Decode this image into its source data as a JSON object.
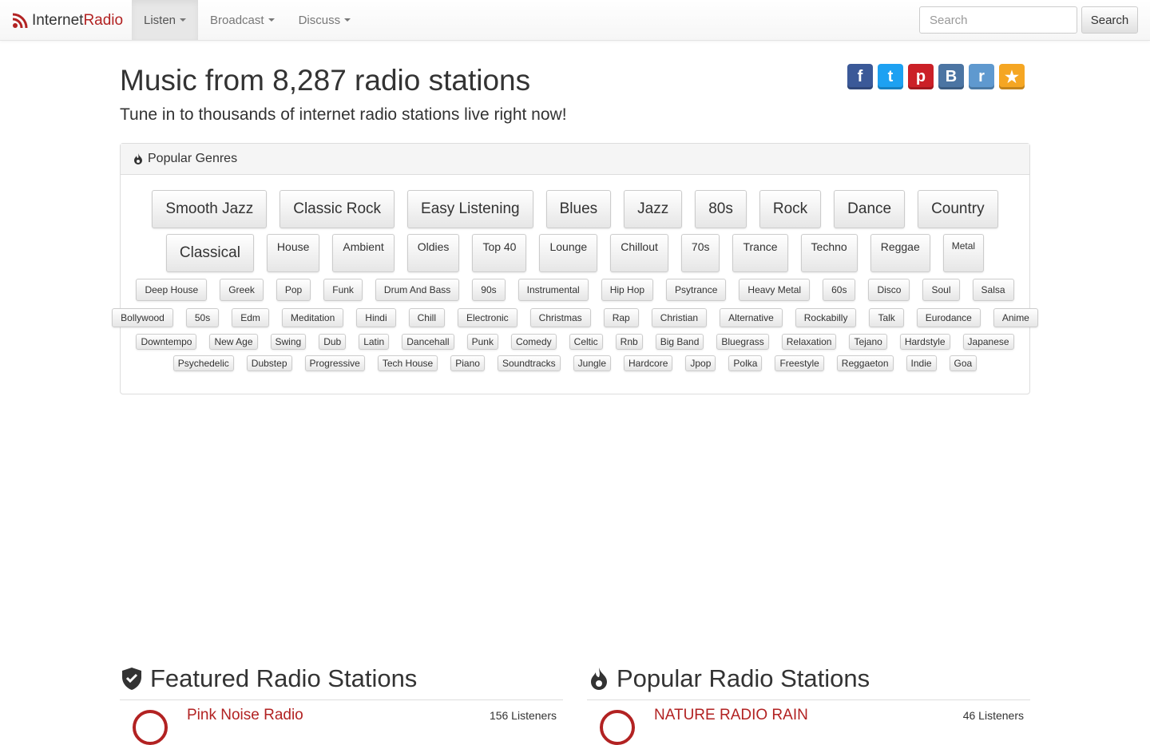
{
  "nav": {
    "brand_part1": "Internet",
    "brand_part2": "Radio",
    "items": [
      {
        "label": "Listen",
        "active": true
      },
      {
        "label": "Broadcast",
        "active": false
      },
      {
        "label": "Discuss",
        "active": false
      }
    ],
    "search_placeholder": "Search",
    "search_button": "Search"
  },
  "hero": {
    "title": "Music from 8,287 radio stations",
    "subtitle": "Tune in to thousands of internet radio stations live right now!"
  },
  "social": [
    {
      "icon": "facebook-icon",
      "glyph": "f",
      "color": "#3b5998"
    },
    {
      "icon": "twitter-icon",
      "glyph": "t",
      "color": "#1da1f2"
    },
    {
      "icon": "pinterest-icon",
      "glyph": "p",
      "color": "#cb2027"
    },
    {
      "icon": "vk-icon",
      "glyph": "B",
      "color": "#4c75a3"
    },
    {
      "icon": "reddit-icon",
      "glyph": "r",
      "color": "#5f99cf"
    },
    {
      "icon": "star-icon",
      "glyph": "★",
      "color": "#f5a623"
    }
  ],
  "genres_panel": {
    "title": "Popular Genres",
    "rows": [
      [
        "Smooth Jazz",
        "Classic Rock",
        "Easy Listening",
        "Blues",
        "Jazz",
        "80s",
        "Rock",
        "Dance",
        "Country"
      ],
      [
        "Classical",
        "House",
        "Ambient",
        "Oldies",
        "Top 40",
        "Lounge",
        "Chillout",
        "70s",
        "Trance",
        "Techno",
        "Reggae",
        "Metal"
      ],
      [
        "Deep House",
        "Greek",
        "Pop",
        "Funk",
        "Drum And Bass",
        "90s",
        "Instrumental",
        "Hip Hop",
        "Psytrance",
        "Heavy Metal",
        "60s",
        "Disco",
        "Soul",
        "Salsa"
      ],
      [
        "Bollywood",
        "50s",
        "Edm",
        "Meditation",
        "Hindi",
        "Chill",
        "Electronic",
        "Christmas",
        "Rap",
        "Christian",
        "Alternative",
        "Rockabilly",
        "Talk",
        "Eurodance",
        "Anime"
      ],
      [
        "Downtempo",
        "New Age",
        "Swing",
        "Dub",
        "Latin",
        "Dancehall",
        "Punk",
        "Comedy",
        "Celtic",
        "Rnb",
        "Big Band",
        "Bluegrass",
        "Relaxation",
        "Tejano",
        "Hardstyle",
        "Japanese"
      ],
      [
        "Psychedelic",
        "Dubstep",
        "Progressive",
        "Tech House",
        "Piano",
        "Soundtracks",
        "Jungle",
        "Hardcore",
        "Jpop",
        "Polka",
        "Freestyle",
        "Reggaeton",
        "Indie",
        "Goa"
      ]
    ]
  },
  "featured": {
    "title": "Featured Radio Stations",
    "first_station": {
      "name": "Pink Noise Radio",
      "listeners": "156 Listeners"
    }
  },
  "popular": {
    "title": "Popular Radio Stations",
    "first_station": {
      "name": "NATURE RADIO RAIN",
      "listeners": "46 Listeners"
    }
  },
  "colors": {
    "brand_red": "#b22222"
  }
}
